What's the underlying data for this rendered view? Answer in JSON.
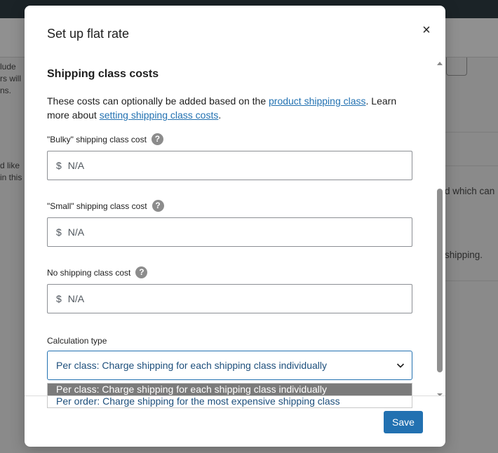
{
  "background": {
    "left_lines": [
      "lude",
      "rs will",
      "ns."
    ],
    "left_lines_2": [
      "d like",
      "in this"
    ],
    "right_line_1": "d which can",
    "right_line_2": "shipping."
  },
  "modal": {
    "title": "Set up flat rate",
    "close_label": "×",
    "section_title": "Shipping class costs",
    "description": {
      "part1": "These costs can optionally be added based on the ",
      "link1": "product shipping class",
      "part2": ". Learn more about ",
      "link2": "setting shipping class costs",
      "part3": "."
    },
    "fields": [
      {
        "label": "\"Bulky\" shipping class cost",
        "currency": "$",
        "placeholder": "N/A"
      },
      {
        "label": "\"Small\" shipping class cost",
        "currency": "$",
        "placeholder": "N/A"
      },
      {
        "label": "No shipping class cost",
        "currency": "$",
        "placeholder": "N/A"
      }
    ],
    "help_icon": "?",
    "calculation": {
      "label": "Calculation type",
      "selected": "Per class: Charge shipping for each shipping class individually",
      "options": [
        "Per class: Charge shipping for each shipping class individually",
        "Per order: Charge shipping for the most expensive shipping class"
      ]
    },
    "save_label": "Save"
  },
  "colors": {
    "accent": "#2271b1",
    "overlay": "#8a8a8a"
  }
}
